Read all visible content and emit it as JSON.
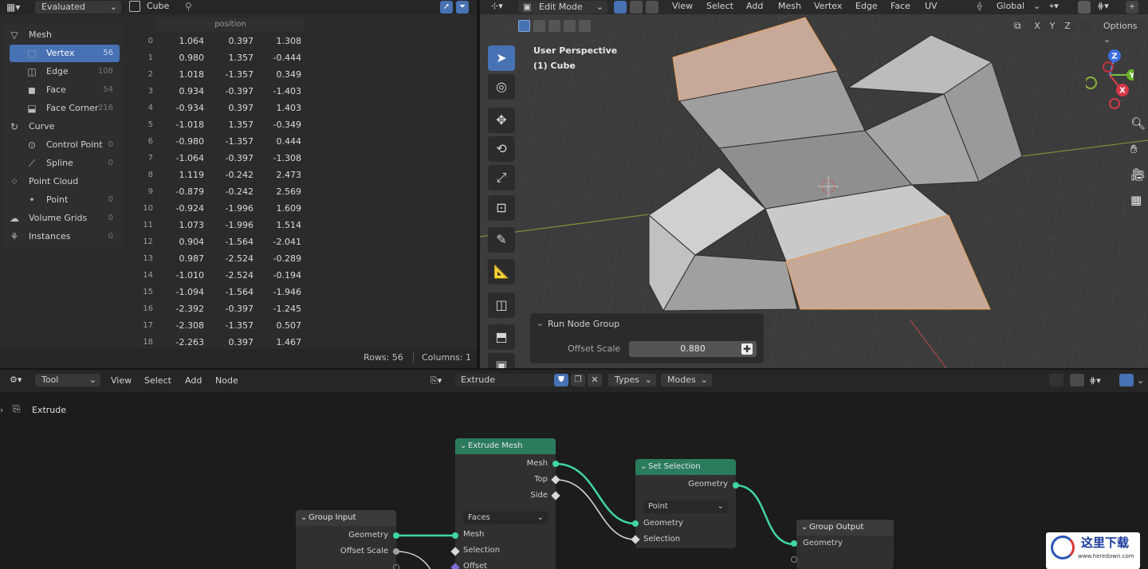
{
  "spreadsheet": {
    "header": {
      "display_mode": "Evaluated",
      "object_name": "Cube"
    },
    "tree": [
      {
        "label": "Mesh",
        "count": "",
        "icon": "mesh-icon",
        "indent": 0,
        "active": false
      },
      {
        "label": "Vertex",
        "count": "56",
        "icon": "vertex-icon",
        "indent": 1,
        "active": true
      },
      {
        "label": "Edge",
        "count": "108",
        "icon": "edge-icon",
        "indent": 1,
        "active": false
      },
      {
        "label": "Face",
        "count": "54",
        "icon": "face-icon",
        "indent": 1,
        "active": false
      },
      {
        "label": "Face Corner",
        "count": "216",
        "icon": "face-corner-icon",
        "indent": 1,
        "active": false
      },
      {
        "label": "Curve",
        "count": "",
        "icon": "curve-icon",
        "indent": 0,
        "active": false
      },
      {
        "label": "Control Point",
        "count": "0",
        "icon": "control-point-icon",
        "indent": 1,
        "active": false
      },
      {
        "label": "Spline",
        "count": "0",
        "icon": "spline-icon",
        "indent": 1,
        "active": false
      },
      {
        "label": "Point Cloud",
        "count": "",
        "icon": "point-cloud-icon",
        "indent": 0,
        "active": false
      },
      {
        "label": "Point",
        "count": "0",
        "icon": "point-icon",
        "indent": 1,
        "active": false
      },
      {
        "label": "Volume Grids",
        "count": "0",
        "icon": "volume-icon",
        "indent": 0,
        "active": false
      },
      {
        "label": "Instances",
        "count": "0",
        "icon": "instances-icon",
        "indent": 0,
        "active": false
      }
    ],
    "column_header": "position",
    "rows": [
      {
        "i": "0",
        "x": "1.064",
        "y": "0.397",
        "z": "1.308"
      },
      {
        "i": "1",
        "x": "0.980",
        "y": "1.357",
        "z": "-0.444"
      },
      {
        "i": "2",
        "x": "1.018",
        "y": "-1.357",
        "z": "0.349"
      },
      {
        "i": "3",
        "x": "0.934",
        "y": "-0.397",
        "z": "-1.403"
      },
      {
        "i": "4",
        "x": "-0.934",
        "y": "0.397",
        "z": "1.403"
      },
      {
        "i": "5",
        "x": "-1.018",
        "y": "1.357",
        "z": "-0.349"
      },
      {
        "i": "6",
        "x": "-0.980",
        "y": "-1.357",
        "z": "0.444"
      },
      {
        "i": "7",
        "x": "-1.064",
        "y": "-0.397",
        "z": "-1.308"
      },
      {
        "i": "8",
        "x": "1.119",
        "y": "-0.242",
        "z": "2.473"
      },
      {
        "i": "9",
        "x": "-0.879",
        "y": "-0.242",
        "z": "2.569"
      },
      {
        "i": "10",
        "x": "-0.924",
        "y": "-1.996",
        "z": "1.609"
      },
      {
        "i": "11",
        "x": "1.073",
        "y": "-1.996",
        "z": "1.514"
      },
      {
        "i": "12",
        "x": "0.904",
        "y": "-1.564",
        "z": "-2.041"
      },
      {
        "i": "13",
        "x": "0.987",
        "y": "-2.524",
        "z": "-0.289"
      },
      {
        "i": "14",
        "x": "-1.010",
        "y": "-2.524",
        "z": "-0.194"
      },
      {
        "i": "15",
        "x": "-1.094",
        "y": "-1.564",
        "z": "-1.946"
      },
      {
        "i": "16",
        "x": "-2.392",
        "y": "-0.397",
        "z": "-1.245"
      },
      {
        "i": "17",
        "x": "-2.308",
        "y": "-1.357",
        "z": "0.507"
      },
      {
        "i": "18",
        "x": "-2.263",
        "y": "0.397",
        "z": "1.467"
      }
    ],
    "footer": {
      "rows": "Rows: 56",
      "columns": "Columns: 1"
    }
  },
  "viewport": {
    "header": {
      "mode": "Edit Mode",
      "menus": [
        "View",
        "Select",
        "Add",
        "Mesh",
        "Vertex",
        "Edge",
        "Face",
        "UV"
      ],
      "transform_orientation": "Global",
      "axes": [
        "X",
        "Y",
        "Z"
      ],
      "options": "Options"
    },
    "overlay": {
      "perspective": "User Perspective",
      "object": "(1) Cube"
    },
    "gizmo": {
      "z": "Z",
      "y": "Y",
      "x": "X"
    },
    "redo_panel": {
      "title": "Run Node Group",
      "label": "Offset Scale",
      "value": "0.880"
    }
  },
  "node_editor": {
    "header": {
      "tool": "Tool",
      "menus": [
        "View",
        "Select",
        "Add",
        "Node"
      ],
      "node_group": "Extrude",
      "types": "Types",
      "modes": "Modes"
    },
    "breadcrumb": "Extrude",
    "nodes": {
      "group_input": {
        "title": "Group Input",
        "outputs": [
          "Geometry",
          "Offset Scale"
        ]
      },
      "extrude_mesh": {
        "title": "Extrude Mesh",
        "outputs": [
          "Mesh",
          "Top",
          "Side"
        ],
        "mode": "Faces",
        "inputs": [
          "Mesh",
          "Selection",
          "Offset"
        ]
      },
      "set_selection": {
        "title": "Set Selection",
        "outputs": [
          "Geometry"
        ],
        "domain": "Point",
        "inputs": [
          "Geometry",
          "Selection"
        ]
      },
      "group_output": {
        "title": "Group Output",
        "inputs": [
          "Geometry"
        ]
      }
    }
  },
  "watermark": {
    "text": "这里下载",
    "url": "www.heredown.com"
  },
  "colors": {
    "accent": "#4772b3",
    "node_header_green": "#2b7c5d",
    "link_green": "#3fd6a3",
    "selection_orange": "#e8a060"
  }
}
